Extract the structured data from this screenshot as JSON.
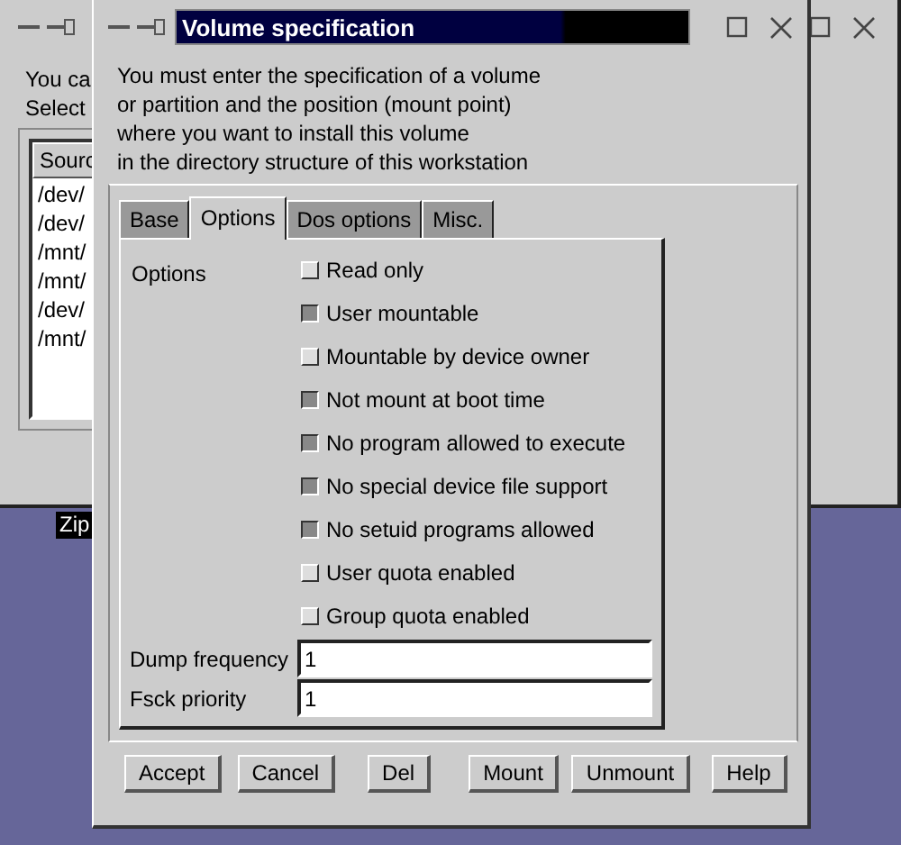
{
  "background_window": {
    "intro_lines": [
      "You ca",
      "Select"
    ],
    "list": {
      "columns": [
        "Sourc"
      ],
      "rows": [
        "/dev/",
        "/dev/",
        "/mnt/",
        "/mnt/",
        "/dev/",
        "/mnt/"
      ]
    }
  },
  "desktop_label": "Zip",
  "dialog": {
    "title": "Volume specification",
    "intro_lines": [
      "You must enter the specification of a volume",
      "or partition and the position (mount point)",
      "where you want to install this volume",
      "in the directory structure of this workstation"
    ],
    "tabs": [
      {
        "label": "Base",
        "selected": false
      },
      {
        "label": "Options",
        "selected": true
      },
      {
        "label": "Dos options",
        "selected": false
      },
      {
        "label": "Misc.",
        "selected": false
      }
    ],
    "options_label": "Options",
    "options": [
      {
        "label": "Read only",
        "checked": false
      },
      {
        "label": "User mountable",
        "checked": true
      },
      {
        "label": "Mountable by device owner",
        "checked": false
      },
      {
        "label": "Not mount at boot time",
        "checked": true
      },
      {
        "label": "No program allowed to execute",
        "checked": true
      },
      {
        "label": "No special device file support",
        "checked": true
      },
      {
        "label": "No setuid programs allowed",
        "checked": true
      },
      {
        "label": "User quota enabled",
        "checked": false
      },
      {
        "label": "Group quota enabled",
        "checked": false
      }
    ],
    "fields": [
      {
        "label": "Dump frequency",
        "value": "1"
      },
      {
        "label": "Fsck priority",
        "value": "1"
      }
    ],
    "buttons": [
      "Accept",
      "Cancel",
      "Del",
      "Mount",
      "Unmount",
      "Help"
    ]
  }
}
